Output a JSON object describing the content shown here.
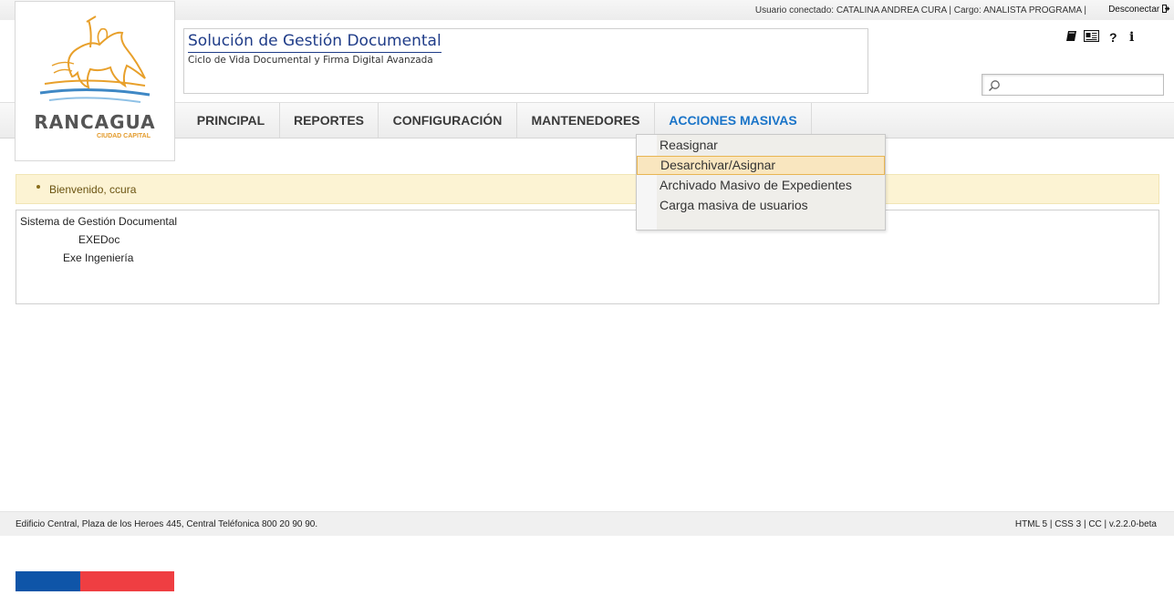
{
  "topbar": {
    "user_info": "Usuario conectado: CATALINA ANDREA CURA | Cargo: ANALISTA PROGRAMA |",
    "logout_label": "Desconectar",
    "logout_icon": "exit-arrow-icon"
  },
  "logo": {
    "title": "RANCAGUA",
    "subtitle": "CIUDAD CAPITAL",
    "colors": {
      "gold": "#e8a02b",
      "blue": "#3f88c5",
      "text": "#555555"
    }
  },
  "app": {
    "title": "Solución de Gestión Documental",
    "subtitle": "Ciclo de Vida Documental y Firma Digital Avanzada"
  },
  "tools": {
    "icons": [
      "book-icon",
      "newspaper-icon",
      "help-icon",
      "info-icon"
    ],
    "help_glyph": "?",
    "info_glyph": "i"
  },
  "search": {
    "placeholder": "",
    "value": ""
  },
  "nav": {
    "items": [
      {
        "label": "PRINCIPAL",
        "active": false
      },
      {
        "label": "REPORTES",
        "active": false
      },
      {
        "label": "CONFIGURACIÓN",
        "active": false
      },
      {
        "label": "MANTENEDORES",
        "active": false
      },
      {
        "label": "ACCIONES MASIVAS",
        "active": true
      }
    ],
    "active_color": "#1a74c8"
  },
  "dropdown": {
    "items": [
      {
        "label": "Reasignar",
        "highlighted": false
      },
      {
        "label": "Desarchivar/Asignar",
        "highlighted": true
      },
      {
        "label": "Archivado Masivo de Expedientes",
        "highlighted": false
      },
      {
        "label": "Carga masiva de usuarios",
        "highlighted": false
      }
    ]
  },
  "welcome": {
    "message": "Bienvenido, ccura"
  },
  "info": {
    "line1": "Sistema de Gestión Documental",
    "line2": "EXEDoc",
    "line3": "Exe Ingeniería"
  },
  "footer": {
    "address": "Edificio Central, Plaza de los Heroes 445, Central Teléfonica 800 20 90 90.",
    "tech": "HTML 5 | CSS 3 | CC | v.2.2.0-beta"
  },
  "colors": {
    "flag_blue": "#0f55a8",
    "flag_red": "#ef3e42",
    "welcome_bg": "#fcf3d3"
  }
}
